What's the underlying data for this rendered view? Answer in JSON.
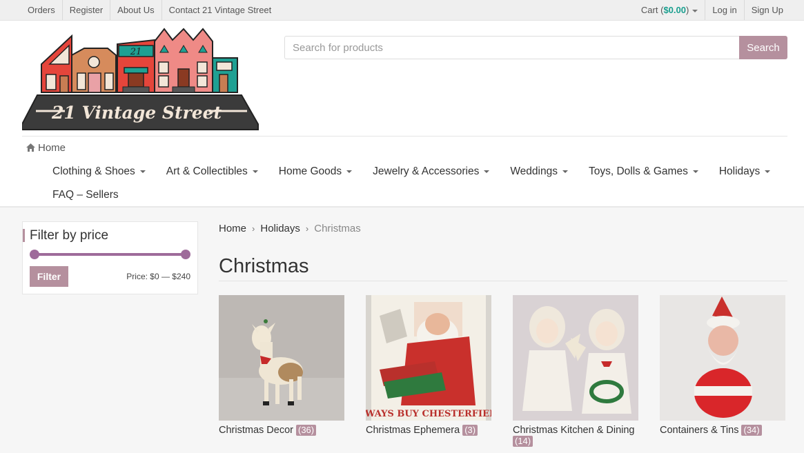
{
  "topbar": {
    "left_links": [
      "Orders",
      "Register",
      "About Us",
      "Contact 21 Vintage Street"
    ],
    "cart_label": "Cart",
    "cart_open": "(",
    "cart_amount": "$0.00",
    "cart_close": ")",
    "login": "Log in",
    "signup": "Sign Up"
  },
  "logo": {
    "number": "21",
    "text": "21 Vintage Street"
  },
  "search": {
    "placeholder": "Search for products",
    "button": "Search"
  },
  "home_link": "Home",
  "nav": {
    "row1": [
      "Clothing & Shoes",
      "Art & Collectibles",
      "Home Goods",
      "Jewelry & Accessories",
      "Weddings",
      "Toys, Dolls & Games",
      "Holidays"
    ],
    "row2": [
      "FAQ – Sellers"
    ]
  },
  "filter": {
    "title": "Filter by price",
    "button": "Filter",
    "price_text": "Price: $0 — $240",
    "range_min_fraction": 0,
    "range_max_fraction": 1
  },
  "breadcrumb": {
    "home": "Home",
    "parent": "Holidays",
    "current": "Christmas"
  },
  "page_title": "Christmas",
  "categories": [
    {
      "name": "Christmas Decor",
      "count": "(36)",
      "icon": "reindeer-figurine-image"
    },
    {
      "name": "Christmas Ephemera",
      "count": "(3)",
      "icon": "santa-ad-image"
    },
    {
      "name": "Christmas Kitchen & Dining",
      "count": "(14)",
      "icon": "angel-figurines-image"
    },
    {
      "name": "Containers & Tins",
      "count": "(34)",
      "icon": "santa-container-image"
    }
  ],
  "colors": {
    "accent": "#b5909e",
    "slider": "#9e6b9a",
    "cart_amount": "#1a9f8f"
  }
}
